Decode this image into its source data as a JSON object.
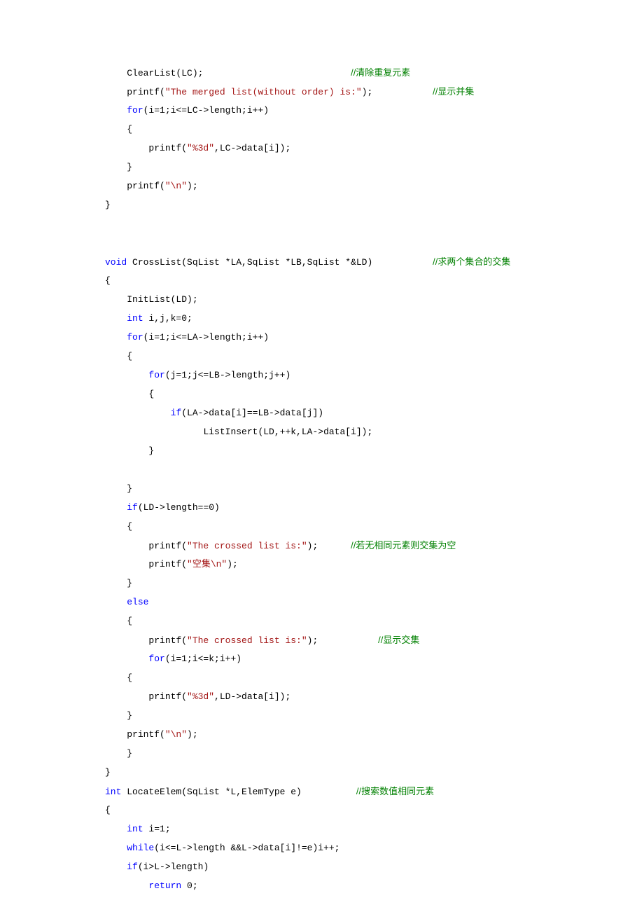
{
  "code": {
    "lines": [
      {
        "indent": 4,
        "segments": [
          {
            "t": "ClearList(LC);                           "
          },
          {
            "t": "//清除重复元素",
            "c": "cmt"
          }
        ]
      },
      {
        "indent": 4,
        "segments": [
          {
            "t": "printf("
          },
          {
            "t": "\"The merged list(without order) is:\"",
            "c": "str"
          },
          {
            "t": ");           "
          },
          {
            "t": "//显示并集",
            "c": "cmt"
          }
        ]
      },
      {
        "indent": 4,
        "segments": [
          {
            "t": "for",
            "c": "kw"
          },
          {
            "t": "(i=1;i<=LC->length;i++)"
          }
        ]
      },
      {
        "indent": 4,
        "segments": [
          {
            "t": "{"
          }
        ]
      },
      {
        "indent": 8,
        "segments": [
          {
            "t": "printf("
          },
          {
            "t": "\"%3d\"",
            "c": "str"
          },
          {
            "t": ",LC->data[i]);"
          }
        ]
      },
      {
        "indent": 4,
        "segments": [
          {
            "t": "}"
          }
        ]
      },
      {
        "indent": 4,
        "segments": [
          {
            "t": "printf("
          },
          {
            "t": "\"\\n\"",
            "c": "str"
          },
          {
            "t": ");"
          }
        ]
      },
      {
        "indent": 0,
        "segments": [
          {
            "t": "}"
          }
        ]
      },
      {
        "indent": 0,
        "segments": [
          {
            "t": ""
          }
        ]
      },
      {
        "indent": 0,
        "segments": [
          {
            "t": ""
          }
        ]
      },
      {
        "indent": 0,
        "segments": [
          {
            "t": "void",
            "c": "kw"
          },
          {
            "t": " CrossList(SqList *LA,SqList *LB,SqList *&LD)           "
          },
          {
            "t": "//求两个集合的交集",
            "c": "cmt"
          }
        ]
      },
      {
        "indent": 0,
        "segments": [
          {
            "t": "{"
          }
        ]
      },
      {
        "indent": 4,
        "segments": [
          {
            "t": "InitList(LD);"
          }
        ]
      },
      {
        "indent": 4,
        "segments": [
          {
            "t": "int",
            "c": "kw"
          },
          {
            "t": " i,j,k=0;"
          }
        ]
      },
      {
        "indent": 4,
        "segments": [
          {
            "t": "for",
            "c": "kw"
          },
          {
            "t": "(i=1;i<=LA->length;i++)"
          }
        ]
      },
      {
        "indent": 4,
        "segments": [
          {
            "t": "{"
          }
        ]
      },
      {
        "indent": 8,
        "segments": [
          {
            "t": "for",
            "c": "kw"
          },
          {
            "t": "(j=1;j<=LB->length;j++)"
          }
        ]
      },
      {
        "indent": 8,
        "segments": [
          {
            "t": "{"
          }
        ]
      },
      {
        "indent": 12,
        "segments": [
          {
            "t": "if",
            "c": "kw"
          },
          {
            "t": "(LA->data[i]==LB->data[j])"
          }
        ]
      },
      {
        "indent": 18,
        "segments": [
          {
            "t": "ListInsert(LD,++k,LA->data[i]);"
          }
        ]
      },
      {
        "indent": 8,
        "segments": [
          {
            "t": "}"
          }
        ]
      },
      {
        "indent": 0,
        "segments": [
          {
            "t": ""
          }
        ]
      },
      {
        "indent": 4,
        "segments": [
          {
            "t": "}"
          }
        ]
      },
      {
        "indent": 4,
        "segments": [
          {
            "t": "if",
            "c": "kw"
          },
          {
            "t": "(LD->length==0)"
          }
        ]
      },
      {
        "indent": 4,
        "segments": [
          {
            "t": "{"
          }
        ]
      },
      {
        "indent": 8,
        "segments": [
          {
            "t": "printf("
          },
          {
            "t": "\"The crossed list is:\"",
            "c": "str"
          },
          {
            "t": ");      "
          },
          {
            "t": "//若无相同元素则交集为空",
            "c": "cmt"
          }
        ]
      },
      {
        "indent": 8,
        "segments": [
          {
            "t": "printf("
          },
          {
            "t": "\"空集\\n\"",
            "c": "str"
          },
          {
            "t": ");"
          }
        ]
      },
      {
        "indent": 4,
        "segments": [
          {
            "t": "}"
          }
        ]
      },
      {
        "indent": 4,
        "segments": [
          {
            "t": "else",
            "c": "kw"
          }
        ]
      },
      {
        "indent": 4,
        "segments": [
          {
            "t": "{"
          }
        ]
      },
      {
        "indent": 8,
        "segments": [
          {
            "t": "printf("
          },
          {
            "t": "\"The crossed list is:\"",
            "c": "str"
          },
          {
            "t": ");           "
          },
          {
            "t": "//显示交集",
            "c": "cmt"
          }
        ]
      },
      {
        "indent": 8,
        "segments": [
          {
            "t": "for",
            "c": "kw"
          },
          {
            "t": "(i=1;i<=k;i++)"
          }
        ]
      },
      {
        "indent": 4,
        "segments": [
          {
            "t": "{"
          }
        ]
      },
      {
        "indent": 8,
        "segments": [
          {
            "t": "printf("
          },
          {
            "t": "\"%3d\"",
            "c": "str"
          },
          {
            "t": ",LD->data[i]);"
          }
        ]
      },
      {
        "indent": 4,
        "segments": [
          {
            "t": "}"
          }
        ]
      },
      {
        "indent": 4,
        "segments": [
          {
            "t": "printf("
          },
          {
            "t": "\"\\n\"",
            "c": "str"
          },
          {
            "t": ");"
          }
        ]
      },
      {
        "indent": 4,
        "segments": [
          {
            "t": "}"
          }
        ]
      },
      {
        "indent": 0,
        "segments": [
          {
            "t": "}"
          }
        ]
      },
      {
        "indent": 0,
        "segments": [
          {
            "t": "int",
            "c": "kw"
          },
          {
            "t": " LocateElem(SqList *L,ElemType e)          "
          },
          {
            "t": "//搜索数值相同元素",
            "c": "cmt"
          }
        ]
      },
      {
        "indent": 0,
        "segments": [
          {
            "t": "{"
          }
        ]
      },
      {
        "indent": 4,
        "segments": [
          {
            "t": "int",
            "c": "kw"
          },
          {
            "t": " i=1;"
          }
        ]
      },
      {
        "indent": 4,
        "segments": [
          {
            "t": "while",
            "c": "kw"
          },
          {
            "t": "(i<=L->length &&L->data[i]!=e)i++;"
          }
        ]
      },
      {
        "indent": 4,
        "segments": [
          {
            "t": "if",
            "c": "kw"
          },
          {
            "t": "(i>L->length)"
          }
        ]
      },
      {
        "indent": 8,
        "segments": [
          {
            "t": "return",
            "c": "kw"
          },
          {
            "t": " 0;"
          }
        ]
      }
    ]
  }
}
